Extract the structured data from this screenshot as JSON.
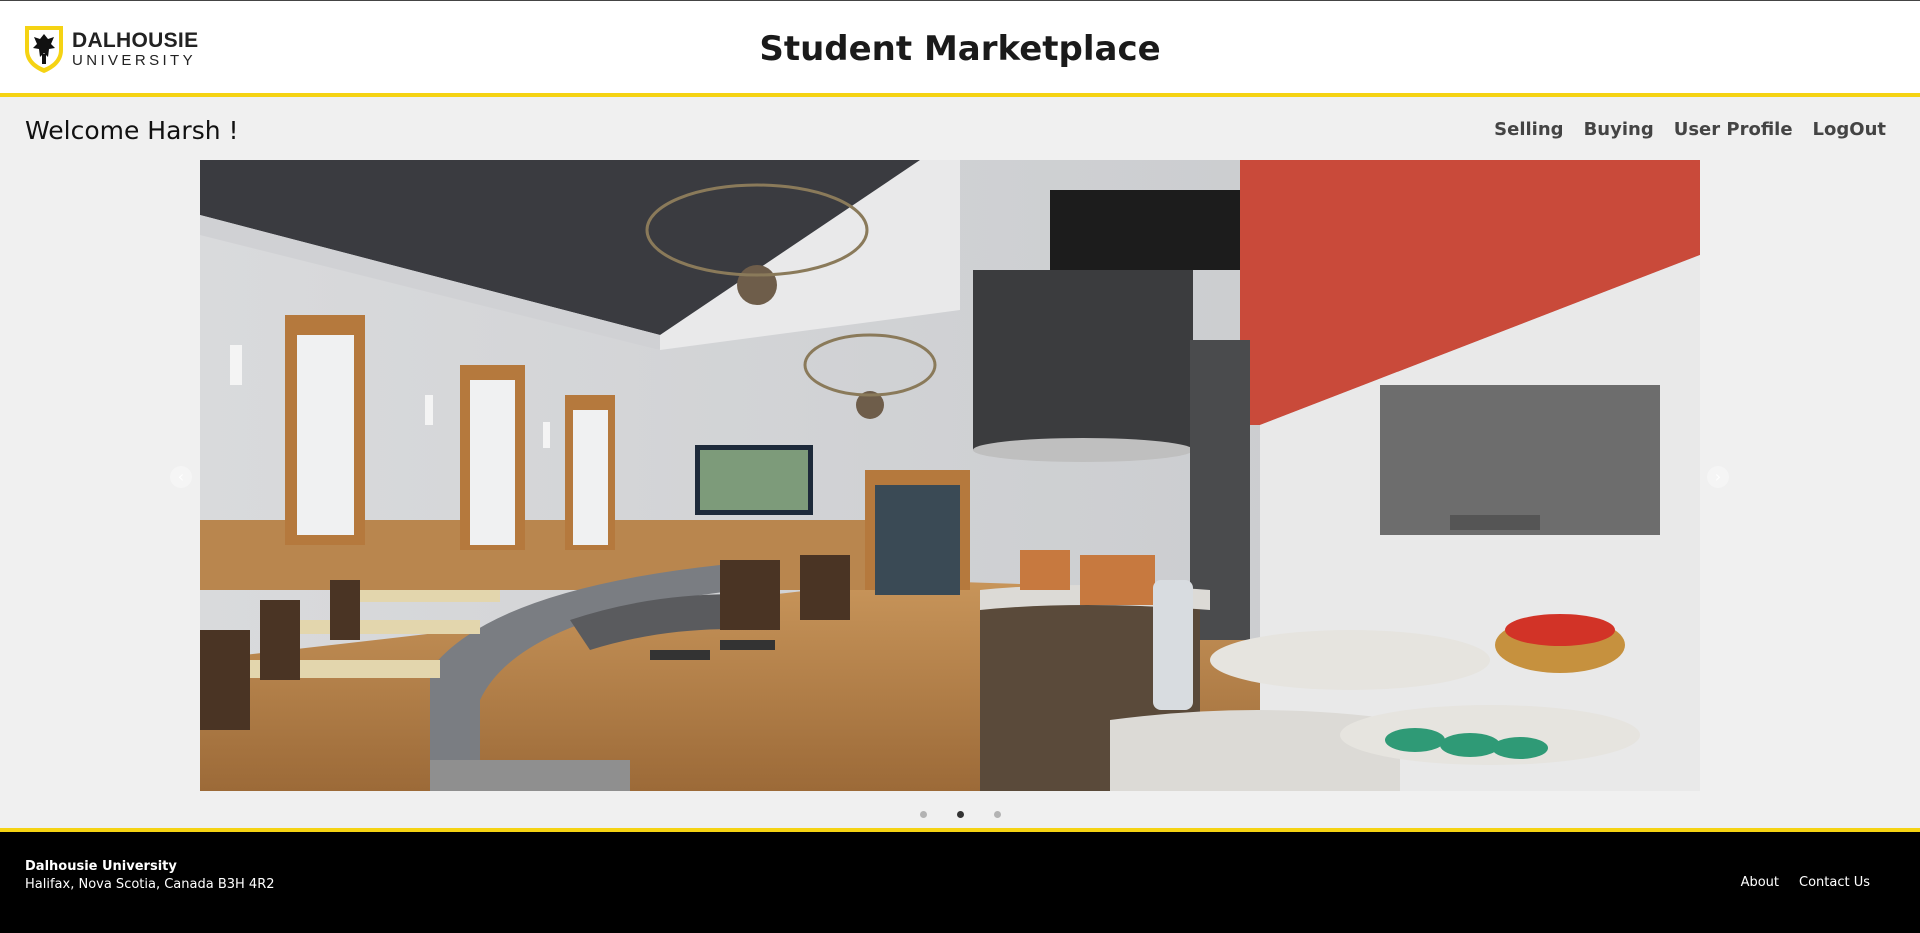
{
  "header": {
    "logo_line1": "DALHOUSIE",
    "logo_line2": "UNIVERSITY",
    "title": "Student Marketplace"
  },
  "welcome": "Welcome Harsh !",
  "nav": {
    "items": [
      {
        "label": "Selling"
      },
      {
        "label": "Buying"
      },
      {
        "label": "User Profile"
      },
      {
        "label": "LogOut"
      }
    ]
  },
  "carousel": {
    "active_slide": 2,
    "slide_count": 3,
    "prev_icon": "chevron-left-icon",
    "next_icon": "chevron-right-icon"
  },
  "footer": {
    "name": "Dalhousie University",
    "address": "Halifax, Nova Scotia, Canada B3H 4R2",
    "links": [
      {
        "label": "About"
      },
      {
        "label": "Contact Us"
      }
    ]
  },
  "colors": {
    "accent": "#f5d313",
    "footer_bg": "#000000",
    "page_bg": "#f0f0f0"
  }
}
